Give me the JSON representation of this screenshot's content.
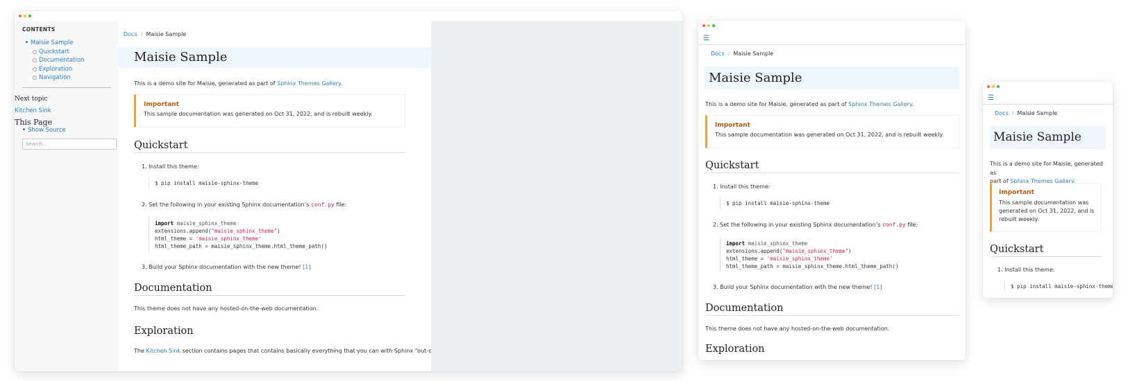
{
  "window_dots": [
    "#ff5f57",
    "#febc2e",
    "#28c840"
  ],
  "colors": {
    "link": "#2f7dc2",
    "admonition": "#e8a23a",
    "header_band": "#eef5fc"
  },
  "menu_icon": "hamburger-menu-icon",
  "sidebar": {
    "heading": "CONTENTS",
    "toc": [
      {
        "label": "Maisie Sample",
        "level": 1
      },
      {
        "label": "Quickstart",
        "level": 2
      },
      {
        "label": "Documentation",
        "level": 2
      },
      {
        "label": "Exploration",
        "level": 2
      },
      {
        "label": "Navigation",
        "level": 2
      }
    ],
    "next_topic_heading": "Next topic",
    "next_topic_link": "Kitchen Sink",
    "this_page_heading": "This Page",
    "show_source": "Show Source",
    "search_placeholder": "Search..."
  },
  "doc": {
    "breadcrumb_root": "Docs",
    "breadcrumb_sep": "/",
    "breadcrumb_current": "Maisie Sample",
    "title": "Maisie Sample",
    "intro_prefix": "This is a demo site for Maisie, generated as part of ",
    "intro_link": "Sphinx Themes Gallery",
    "intro_suffix": ".",
    "admonition_title": "Important",
    "admonition_text": "This sample documentation was generated on Oct 31, 2022, and is rebuilt weekly.",
    "quickstart_heading": "Quickstart",
    "step1": "1. Install this theme:",
    "install_cmd": "$ pip install maisie-sphinx-theme",
    "step2_prefix": "2. Set the following in your existing Sphinx documentation’s ",
    "step2_code": "conf.py",
    "step2_suffix": " file:",
    "code_import_kw": "import",
    "code_import_mod": " maisie_sphinx_theme",
    "code_line2_a": "extensions.append(",
    "code_line2_str": "\"maisie_sphinx_theme\"",
    "code_line2_b": ")",
    "code_line3_a": "html_theme = ",
    "code_line3_str": "'maisie_sphinx_theme'",
    "code_line4": "html_theme_path = maisie_sphinx_theme.html_theme_path()",
    "step3": "3. Build your Sphinx documentation with the new theme! ",
    "step3_ref": "[1]",
    "documentation_heading": "Documentation",
    "documentation_text": "This theme does not have any hosted-on-the-web documentation.",
    "exploration_heading": "Exploration",
    "exploration_prefix": "The ",
    "exploration_link": "Kitchen Sink",
    "exploration_suffix": " section contains pages that contains basically everything that you can with Sphinx “out-of-",
    "w3_intro_line1": "This is a demo site for Maisie, generated as",
    "w3_intro_line2": "part of ",
    "w3_admon_line1": "This sample documentation was",
    "w3_admon_line2": "generated on Oct 31, 2022, and is",
    "w3_admon_line3": "rebuilt weekly."
  }
}
